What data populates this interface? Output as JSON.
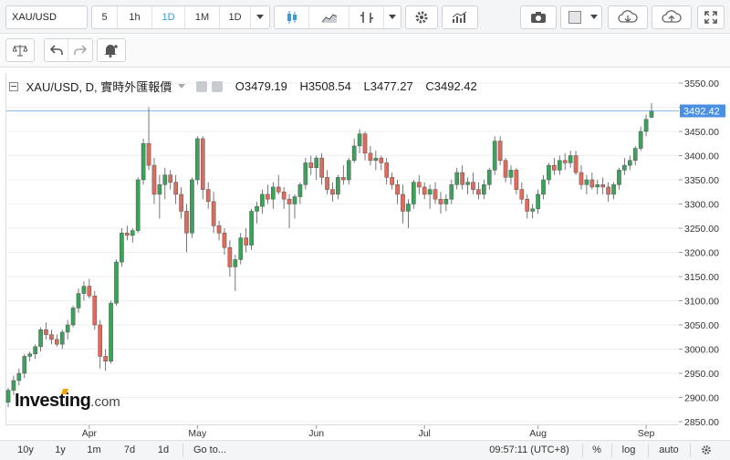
{
  "toolbar": {
    "symbol": "XAU/USD",
    "intervals": [
      "5",
      "1h",
      "1D",
      "1M",
      "1D"
    ],
    "active_interval_index": 2,
    "icons": [
      "chevron-down-icon",
      "candlestick-icon",
      "area-chart-icon",
      "bar-chart-icon",
      "chevron-down-icon",
      "gear-icon",
      "indicators-icon",
      "camera-icon",
      "color-swatch-icon",
      "chevron-down-icon",
      "cloud-download-icon",
      "cloud-upload-icon",
      "fullscreen-icon"
    ]
  },
  "toolbar2": {
    "icons": [
      "balance-icon",
      "undo-icon",
      "redo-icon",
      "alert-add-icon"
    ]
  },
  "legend": {
    "title": "XAU/USD, D, 實時外匯報價",
    "open_label": "O",
    "open": "3479.19",
    "high_label": "H",
    "high": "3508.54",
    "low_label": "L",
    "low": "3477.27",
    "close_label": "C",
    "close": "3492.42"
  },
  "price_tag": "3492.42",
  "bottom_bar": {
    "ranges": [
      "10y",
      "1y",
      "1m",
      "7d",
      "1d"
    ],
    "goto": "Go to...",
    "time": "09:57:11 (UTC+8)",
    "percent": "%",
    "log": "log",
    "auto": "auto"
  },
  "logo": {
    "main": "Investing",
    "suffix": ".com"
  },
  "colors": {
    "up": "#3aa35a",
    "down": "#e06a5c",
    "border": "#555555",
    "accent": "#4a90e2",
    "grid": "#eef0f2"
  },
  "chart_data": {
    "type": "candlestick",
    "title": "XAU/USD, D, 實時外匯報價",
    "y_ticks": [
      3550,
      3500,
      3450,
      3400,
      3350,
      3300,
      3250,
      3200,
      3150,
      3100,
      3050,
      3000,
      2950,
      2900,
      2850
    ],
    "y_tick_labels": [
      "3550.00",
      "3500.00",
      "3450.00",
      "3400.00",
      "3350.00",
      "3300.00",
      "3250.00",
      "3200.00",
      "3150.00",
      "3100.00",
      "3050.00",
      "3000.00",
      "2950.00",
      "2900.00",
      "2850.00"
    ],
    "ylim": [
      2850,
      3570
    ],
    "x_tick_labels": [
      "Apr",
      "May",
      "Jun",
      "Jul",
      "Aug",
      "Sep"
    ],
    "x_tick_candle_index": [
      15,
      35,
      57,
      77,
      98,
      118
    ],
    "last_price": 3492.42,
    "candles": [
      [
        2890,
        2920,
        2880,
        2915
      ],
      [
        2915,
        2945,
        2905,
        2935
      ],
      [
        2935,
        2960,
        2925,
        2950
      ],
      [
        2950,
        2990,
        2940,
        2985
      ],
      [
        2985,
        2995,
        2975,
        2990
      ],
      [
        2990,
        3010,
        2980,
        3005
      ],
      [
        3005,
        3045,
        2995,
        3040
      ],
      [
        3040,
        3055,
        3020,
        3030
      ],
      [
        3030,
        3040,
        3010,
        3020
      ],
      [
        3020,
        3030,
        3005,
        3010
      ],
      [
        3010,
        3040,
        3000,
        3035
      ],
      [
        3035,
        3060,
        3020,
        3050
      ],
      [
        3050,
        3090,
        3045,
        3085
      ],
      [
        3085,
        3125,
        3075,
        3115
      ],
      [
        3115,
        3140,
        3100,
        3130
      ],
      [
        3130,
        3145,
        3105,
        3110
      ],
      [
        3110,
        3120,
        3040,
        3050
      ],
      [
        3050,
        3060,
        2960,
        2985
      ],
      [
        2985,
        3000,
        2955,
        2975
      ],
      [
        2975,
        3100,
        2970,
        3095
      ],
      [
        3095,
        3185,
        3090,
        3180
      ],
      [
        3180,
        3250,
        3170,
        3240
      ],
      [
        3240,
        3255,
        3225,
        3235
      ],
      [
        3235,
        3250,
        3220,
        3245
      ],
      [
        3245,
        3355,
        3240,
        3350
      ],
      [
        3350,
        3435,
        3340,
        3425
      ],
      [
        3425,
        3500,
        3370,
        3380
      ],
      [
        3380,
        3395,
        3300,
        3320
      ],
      [
        3320,
        3360,
        3270,
        3340
      ],
      [
        3340,
        3375,
        3310,
        3360
      ],
      [
        3360,
        3370,
        3330,
        3345
      ],
      [
        3345,
        3360,
        3300,
        3320
      ],
      [
        3320,
        3335,
        3270,
        3285
      ],
      [
        3285,
        3300,
        3200,
        3240
      ],
      [
        3240,
        3355,
        3230,
        3350
      ],
      [
        3350,
        3440,
        3340,
        3435
      ],
      [
        3435,
        3440,
        3310,
        3330
      ],
      [
        3330,
        3345,
        3290,
        3305
      ],
      [
        3305,
        3325,
        3240,
        3255
      ],
      [
        3255,
        3265,
        3225,
        3240
      ],
      [
        3240,
        3250,
        3195,
        3210
      ],
      [
        3210,
        3225,
        3150,
        3170
      ],
      [
        3170,
        3195,
        3120,
        3185
      ],
      [
        3185,
        3240,
        3175,
        3230
      ],
      [
        3230,
        3250,
        3200,
        3215
      ],
      [
        3215,
        3290,
        3205,
        3285
      ],
      [
        3285,
        3305,
        3260,
        3295
      ],
      [
        3295,
        3330,
        3280,
        3320
      ],
      [
        3320,
        3340,
        3300,
        3310
      ],
      [
        3310,
        3345,
        3290,
        3335
      ],
      [
        3335,
        3360,
        3320,
        3325
      ],
      [
        3325,
        3335,
        3290,
        3310
      ],
      [
        3310,
        3320,
        3250,
        3300
      ],
      [
        3300,
        3320,
        3270,
        3315
      ],
      [
        3315,
        3345,
        3300,
        3340
      ],
      [
        3340,
        3395,
        3330,
        3385
      ],
      [
        3385,
        3400,
        3360,
        3375
      ],
      [
        3375,
        3400,
        3350,
        3395
      ],
      [
        3395,
        3405,
        3340,
        3355
      ],
      [
        3355,
        3370,
        3320,
        3330
      ],
      [
        3330,
        3345,
        3305,
        3320
      ],
      [
        3320,
        3360,
        3310,
        3355
      ],
      [
        3355,
        3380,
        3340,
        3350
      ],
      [
        3350,
        3395,
        3340,
        3390
      ],
      [
        3390,
        3435,
        3385,
        3420
      ],
      [
        3420,
        3455,
        3405,
        3445
      ],
      [
        3445,
        3450,
        3390,
        3405
      ],
      [
        3405,
        3420,
        3380,
        3390
      ],
      [
        3390,
        3410,
        3370,
        3395
      ],
      [
        3395,
        3400,
        3370,
        3385
      ],
      [
        3385,
        3395,
        3340,
        3355
      ],
      [
        3355,
        3365,
        3330,
        3340
      ],
      [
        3340,
        3350,
        3300,
        3320
      ],
      [
        3320,
        3340,
        3260,
        3285
      ],
      [
        3285,
        3310,
        3250,
        3300
      ],
      [
        3300,
        3350,
        3290,
        3345
      ],
      [
        3345,
        3360,
        3320,
        3335
      ],
      [
        3335,
        3345,
        3310,
        3320
      ],
      [
        3320,
        3340,
        3290,
        3330
      ],
      [
        3330,
        3345,
        3300,
        3310
      ],
      [
        3310,
        3325,
        3280,
        3300
      ],
      [
        3300,
        3320,
        3285,
        3310
      ],
      [
        3310,
        3350,
        3300,
        3340
      ],
      [
        3340,
        3375,
        3330,
        3365
      ],
      [
        3365,
        3380,
        3330,
        3340
      ],
      [
        3340,
        3355,
        3320,
        3345
      ],
      [
        3345,
        3365,
        3320,
        3330
      ],
      [
        3330,
        3345,
        3310,
        3320
      ],
      [
        3320,
        3350,
        3310,
        3340
      ],
      [
        3340,
        3375,
        3330,
        3370
      ],
      [
        3370,
        3440,
        3360,
        3430
      ],
      [
        3430,
        3440,
        3380,
        3390
      ],
      [
        3390,
        3395,
        3345,
        3355
      ],
      [
        3355,
        3380,
        3340,
        3370
      ],
      [
        3370,
        3375,
        3320,
        3330
      ],
      [
        3330,
        3345,
        3300,
        3310
      ],
      [
        3310,
        3320,
        3270,
        3285
      ],
      [
        3285,
        3300,
        3270,
        3290
      ],
      [
        3290,
        3330,
        3280,
        3320
      ],
      [
        3320,
        3360,
        3310,
        3350
      ],
      [
        3350,
        3385,
        3340,
        3380
      ],
      [
        3380,
        3395,
        3360,
        3370
      ],
      [
        3370,
        3400,
        3360,
        3390
      ],
      [
        3390,
        3405,
        3370,
        3385
      ],
      [
        3385,
        3410,
        3375,
        3400
      ],
      [
        3400,
        3410,
        3360,
        3365
      ],
      [
        3365,
        3380,
        3330,
        3340
      ],
      [
        3340,
        3360,
        3320,
        3350
      ],
      [
        3350,
        3365,
        3330,
        3335
      ],
      [
        3335,
        3350,
        3320,
        3340
      ],
      [
        3340,
        3355,
        3320,
        3335
      ],
      [
        3335,
        3345,
        3305,
        3320
      ],
      [
        3320,
        3345,
        3310,
        3340
      ],
      [
        3340,
        3375,
        3330,
        3370
      ],
      [
        3370,
        3395,
        3360,
        3380
      ],
      [
        3380,
        3400,
        3370,
        3390
      ],
      [
        3390,
        3420,
        3380,
        3415
      ],
      [
        3415,
        3460,
        3410,
        3450
      ],
      [
        3450,
        3485,
        3440,
        3475
      ],
      [
        3479.19,
        3508.54,
        3477.27,
        3492.42
      ]
    ]
  }
}
